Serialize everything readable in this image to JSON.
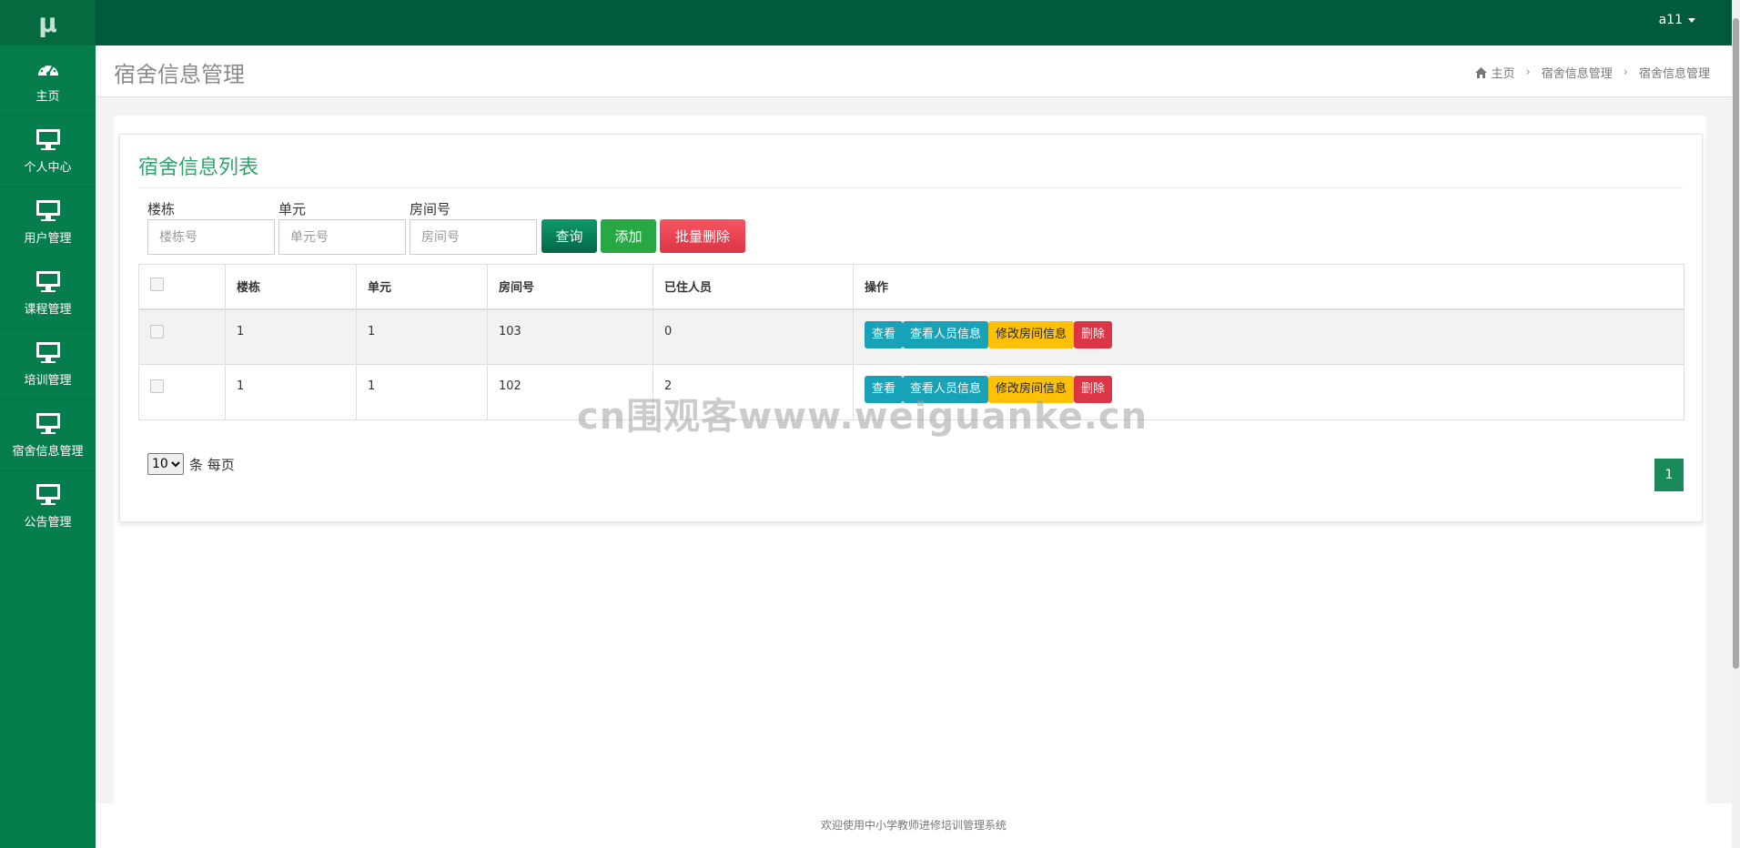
{
  "app": {
    "logo": "μ",
    "user": "a11"
  },
  "sidebar": {
    "items": [
      {
        "label": "主页",
        "icon": "dashboard-icon"
      },
      {
        "label": "个人中心",
        "icon": "monitor-icon"
      },
      {
        "label": "用户管理",
        "icon": "monitor-icon"
      },
      {
        "label": "课程管理",
        "icon": "monitor-icon"
      },
      {
        "label": "培训管理",
        "icon": "monitor-icon"
      },
      {
        "label": "宿舍信息管理",
        "icon": "monitor-icon"
      },
      {
        "label": "公告管理",
        "icon": "monitor-icon"
      }
    ]
  },
  "header": {
    "title": "宿舍信息管理",
    "breadcrumb": [
      "主页",
      "宿舍信息管理",
      "宿舍信息管理"
    ]
  },
  "panel": {
    "title": "宿舍信息列表",
    "filters": [
      {
        "label": "楼栋",
        "placeholder": "楼栋号",
        "value": ""
      },
      {
        "label": "单元",
        "placeholder": "单元号",
        "value": ""
      },
      {
        "label": "房间号",
        "placeholder": "房间号",
        "value": ""
      }
    ],
    "buttons": {
      "query": "查询",
      "add": "添加",
      "batch_delete": "批量删除"
    }
  },
  "table": {
    "columns": [
      "",
      "楼栋",
      "单元",
      "房间号",
      "已住人员",
      "操作"
    ],
    "rows": [
      {
        "building": "1",
        "unit": "1",
        "room": "103",
        "residents": "0"
      },
      {
        "building": "1",
        "unit": "1",
        "room": "102",
        "residents": "2"
      }
    ],
    "actions": {
      "view": "查看",
      "view_people": "查看人员信息",
      "edit_room": "修改房间信息",
      "delete": "删除"
    }
  },
  "pagination": {
    "page_size": "10",
    "page_size_suffix": "条 每页",
    "current_page": "1"
  },
  "footer": {
    "text": "欢迎使用中小学教师进修培训管理系统"
  },
  "watermark": "cn围观客www.weiguanke.cn",
  "colors": {
    "sidebar": "#057d4d",
    "topbar": "#015a3b",
    "accent": "#2fa46a",
    "info": "#17a2b8",
    "warning": "#ffc107",
    "danger": "#dc3545"
  }
}
